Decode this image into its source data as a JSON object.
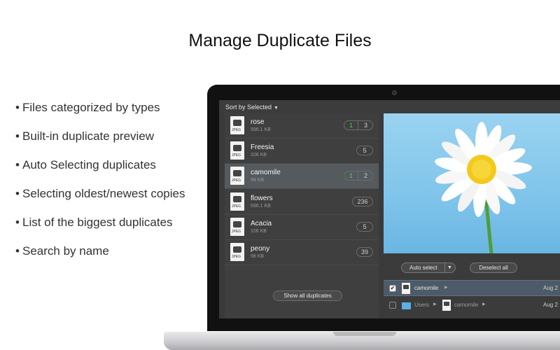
{
  "headline": "Manage Duplicate Files",
  "features": [
    "Files categorized by types",
    "Built-in duplicate preview",
    "Auto Selecting duplicates",
    "Selecting oldest/newest copies",
    "List of the biggest duplicates",
    "Search by name"
  ],
  "app": {
    "sort_label": "Sort by Selected",
    "files": [
      {
        "name": "rose",
        "size": "596.1 KB",
        "ext": "JPEG",
        "selected_count": "1",
        "total_count": "3"
      },
      {
        "name": "Freesia",
        "size": "106 KB",
        "ext": "JPEG",
        "count": "5"
      },
      {
        "name": "camomile",
        "size": "98 KB",
        "ext": "JPEG",
        "selected_count": "1",
        "total_count": "2"
      },
      {
        "name": "flowers",
        "size": "596.1 KB",
        "ext": "JPEG",
        "count": "236"
      },
      {
        "name": "Acacia",
        "size": "106 KB",
        "ext": "JPEG",
        "count": "5"
      },
      {
        "name": "peony",
        "size": "98 KB",
        "ext": "JPEG",
        "count": "39"
      }
    ],
    "show_all_label": "Show all duplicates",
    "auto_select_label": "Auto select",
    "deselect_label": "Deselect all",
    "duplicates": [
      {
        "name": "camomile",
        "date": "Aug 2",
        "checked": true
      },
      {
        "folder": "Users",
        "name": "camomile",
        "date": "Aug 2",
        "checked": false
      }
    ]
  },
  "colors": {
    "selected_count": "#4cd15a",
    "selected_row": "#4d5a68",
    "preview_sky": "#7fc4ea",
    "folder": "#5ab0e3"
  }
}
